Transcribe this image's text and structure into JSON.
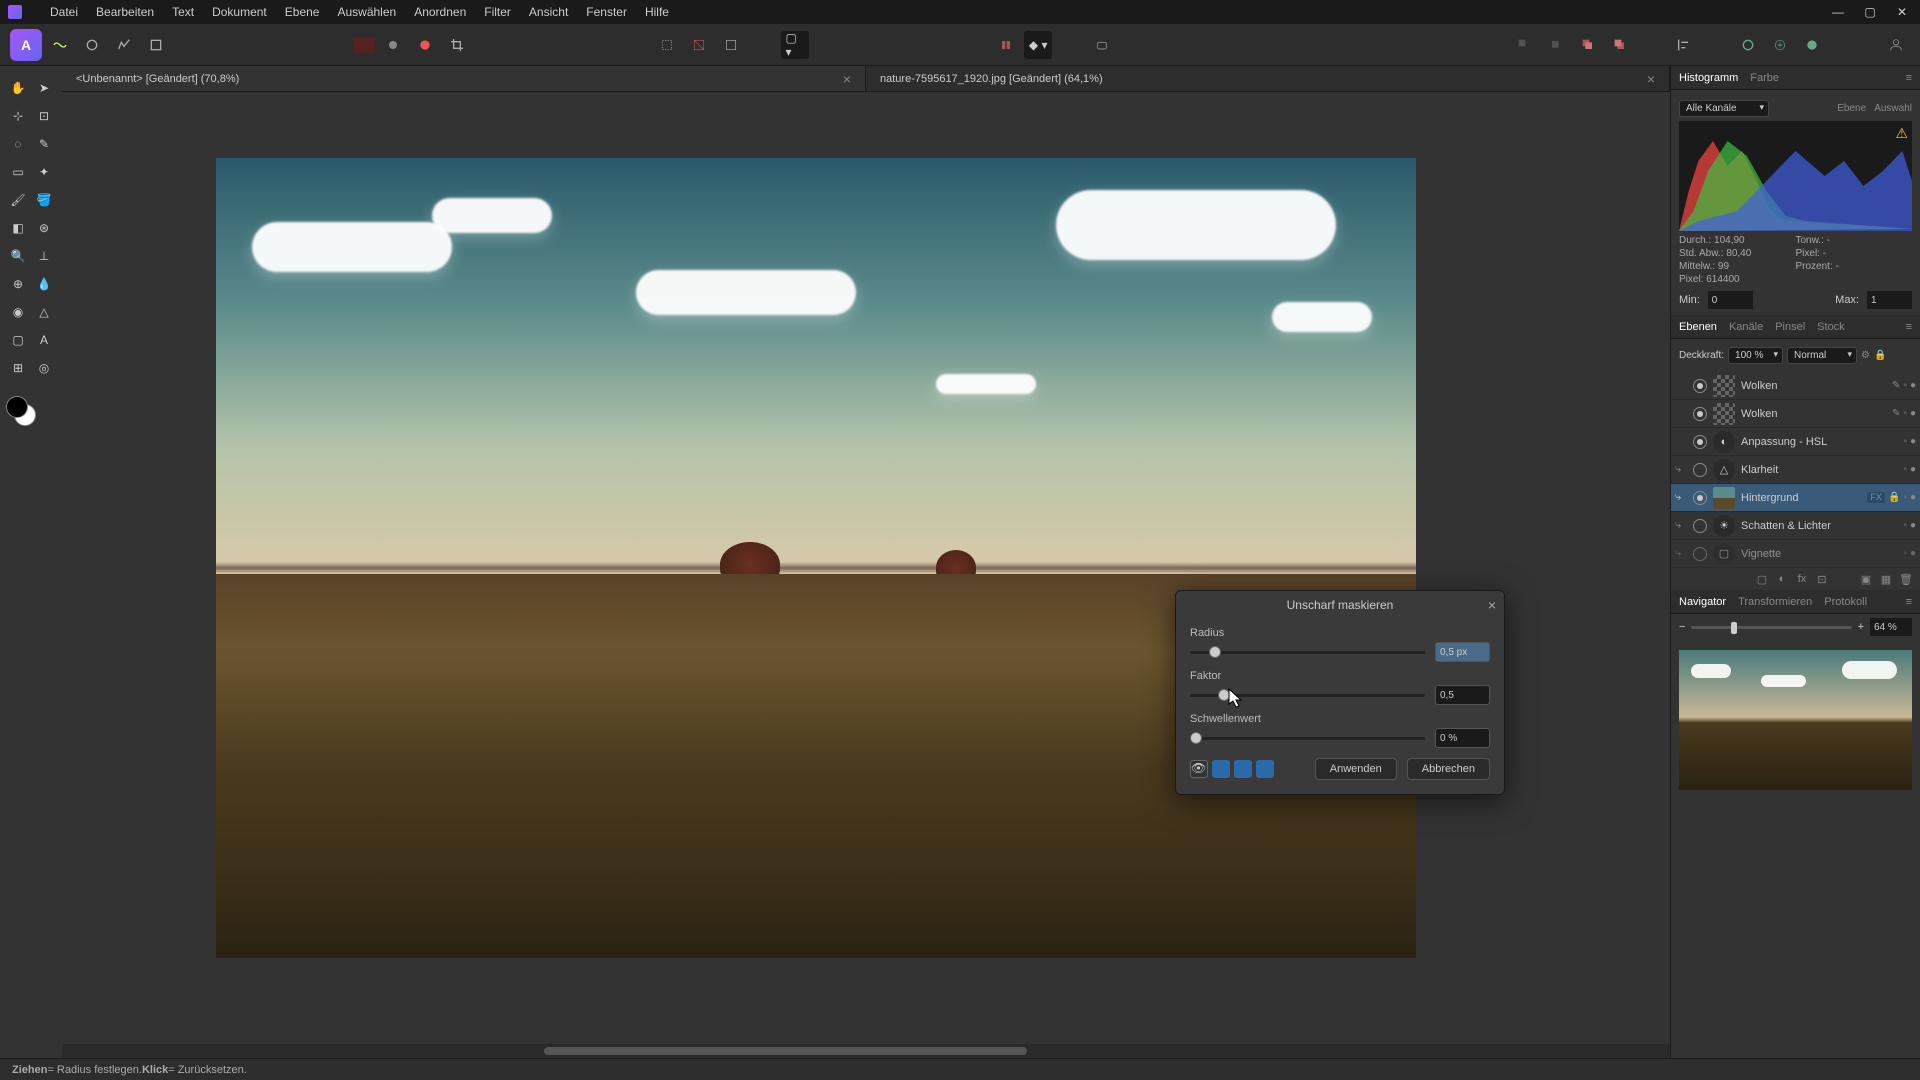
{
  "menu": [
    "Datei",
    "Bearbeiten",
    "Text",
    "Dokument",
    "Ebene",
    "Auswählen",
    "Anordnen",
    "Filter",
    "Ansicht",
    "Fenster",
    "Hilfe"
  ],
  "tabs": [
    {
      "label": "<Unbenannt> [Geändert] (70,8%)",
      "active": true
    },
    {
      "label": "nature-7595617_1920.jpg [Geändert] (64,1%)",
      "active": false
    }
  ],
  "histogram_panel": {
    "tab1": "Histogramm",
    "tab2": "Farbe",
    "channels": "Alle Kanäle",
    "opt1": "Ebene",
    "opt2": "Auswahl",
    "stats": {
      "durch": "Durch.: 104,90",
      "tonw": "Tonw.: -",
      "stdabw": "Std. Abw.: 80,40",
      "pixel2": "Pixel: -",
      "mittelw": "Mittelw.: 99",
      "prozent": "Prozent: -",
      "pixel": "Pixel: 614400"
    },
    "min_label": "Min:",
    "min_val": "0",
    "max_label": "Max:",
    "max_val": "1"
  },
  "layers_panel": {
    "tab1": "Ebenen",
    "tab2": "Kanäle",
    "tab3": "Pinsel",
    "tab4": "Stock",
    "opacity_label": "Deckkraft:",
    "opacity_val": "100 %",
    "blend": "Normal",
    "layers": [
      {
        "name": "Wolken",
        "type": "pixel",
        "vis": true
      },
      {
        "name": "Wolken",
        "type": "pixel",
        "vis": true
      },
      {
        "name": "Anpassung - HSL",
        "type": "adjust-circle",
        "vis": true
      },
      {
        "name": "Klarheit",
        "type": "adjust-tri",
        "vis": false
      },
      {
        "name": "Hintergrund",
        "type": "image",
        "vis": true,
        "selected": true,
        "fx": "FX"
      },
      {
        "name": "Schatten & Lichter",
        "type": "adjust-sun",
        "vis": false
      },
      {
        "name": "Vignette",
        "type": "adjust-box",
        "vis": false
      }
    ]
  },
  "navigator_panel": {
    "tab1": "Navigator",
    "tab2": "Transformieren",
    "tab3": "Protokoll",
    "zoom": "64 %"
  },
  "dialog": {
    "title": "Unscharf maskieren",
    "radius_label": "Radius",
    "radius_val": "0,5 px",
    "factor_label": "Faktor",
    "factor_val": "0,5",
    "threshold_label": "Schwellenwert",
    "threshold_val": "0 %",
    "apply": "Anwenden",
    "cancel": "Abbrechen"
  },
  "status": {
    "drag": "Ziehen",
    "drag_desc": " = Radius festlegen. ",
    "click": "Klick",
    "click_desc": " = Zurücksetzen."
  }
}
